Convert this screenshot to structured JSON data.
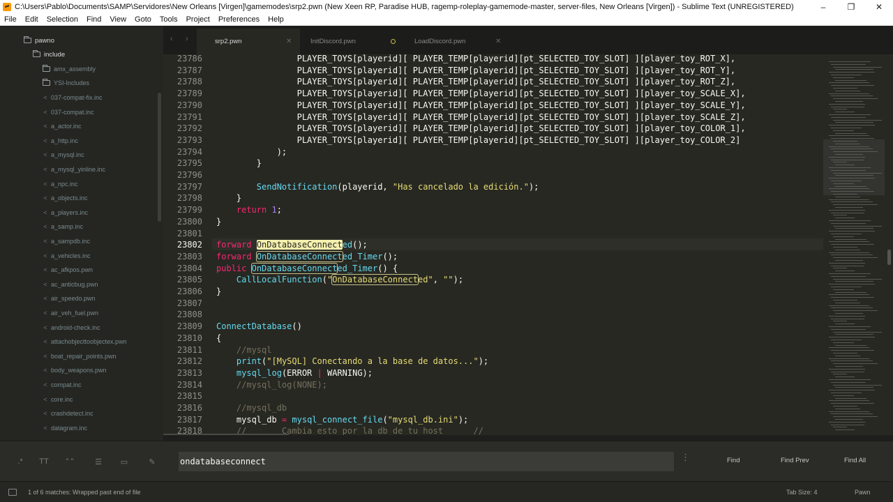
{
  "window": {
    "title": "C:\\Users\\Pablo\\Documents\\SAMP\\Servidores\\New Orleans [Virgen]\\gamemodes\\srp2.pwn (New Xeen RP, Paradise HUB, ragemp-roleplay-gamemode-master, server-files, New Orleans [Virgen]) - Sublime Text (UNREGISTERED)",
    "minimize": "–",
    "maximize": "❐",
    "close": "✕"
  },
  "menu": [
    "File",
    "Edit",
    "Selection",
    "Find",
    "View",
    "Goto",
    "Tools",
    "Project",
    "Preferences",
    "Help"
  ],
  "sidebar": {
    "folders": [
      {
        "label": "pawno",
        "level": 0
      },
      {
        "label": "include",
        "level": 1
      },
      {
        "label": "amx_assembly",
        "level": 2
      },
      {
        "label": "YSI-Includes",
        "level": 2
      }
    ],
    "files": [
      "037-compat-fix.inc",
      "037-compat.inc",
      "a_actor.inc",
      "a_http.inc",
      "a_mysql.inc",
      "a_mysql_yinline.inc",
      "a_npc.inc",
      "a_objects.inc",
      "a_players.inc",
      "a_samp.inc",
      "a_sampdb.inc",
      "a_vehicles.inc",
      "ac_afkpos.pwn",
      "ac_anticbug.pwn",
      "air_speedo.pwn",
      "air_veh_fuel.pwn",
      "android-check.inc",
      "attachobjecttoobjectex.pwn",
      "boat_repair_points.pwn",
      "body_weapons.pwn",
      "compat.inc",
      "core.inc",
      "crashdetect.inc",
      "datagram.inc"
    ]
  },
  "tabs": [
    {
      "label": "srp2.pwn",
      "active": true,
      "dirty": false
    },
    {
      "label": "InitDiscord.pwn",
      "active": false,
      "dirty": true
    },
    {
      "label": "LoadDiscord.pwn",
      "active": false,
      "dirty": false
    }
  ],
  "tab_nav": {
    "back": "‹",
    "forward": "›",
    "close": "✕"
  },
  "editor": {
    "current_line": "23802",
    "lines": [
      {
        "no": "23786",
        "code": "                PLAYER_TOYS[playerid][ PLAYER_TEMP[playerid][pt_SELECTED_TOY_SLOT] ][player_toy_ROT_X],"
      },
      {
        "no": "23787",
        "code": "                PLAYER_TOYS[playerid][ PLAYER_TEMP[playerid][pt_SELECTED_TOY_SLOT] ][player_toy_ROT_Y],"
      },
      {
        "no": "23788",
        "code": "                PLAYER_TOYS[playerid][ PLAYER_TEMP[playerid][pt_SELECTED_TOY_SLOT] ][player_toy_ROT_Z],"
      },
      {
        "no": "23789",
        "code": "                PLAYER_TOYS[playerid][ PLAYER_TEMP[playerid][pt_SELECTED_TOY_SLOT] ][player_toy_SCALE_X],"
      },
      {
        "no": "23790",
        "code": "                PLAYER_TOYS[playerid][ PLAYER_TEMP[playerid][pt_SELECTED_TOY_SLOT] ][player_toy_SCALE_Y],"
      },
      {
        "no": "23791",
        "code": "                PLAYER_TOYS[playerid][ PLAYER_TEMP[playerid][pt_SELECTED_TOY_SLOT] ][player_toy_SCALE_Z],"
      },
      {
        "no": "23792",
        "code": "                PLAYER_TOYS[playerid][ PLAYER_TEMP[playerid][pt_SELECTED_TOY_SLOT] ][player_toy_COLOR_1],"
      },
      {
        "no": "23793",
        "code": "                PLAYER_TOYS[playerid][ PLAYER_TEMP[playerid][pt_SELECTED_TOY_SLOT] ][player_toy_COLOR_2]"
      },
      {
        "no": "23794",
        "code": "            );"
      },
      {
        "no": "23795",
        "code": "        }"
      },
      {
        "no": "23796",
        "code": ""
      },
      {
        "no": "23797",
        "code": "        SendNotification(playerid, \"Has cancelado la edición.\");"
      },
      {
        "no": "23798",
        "code": "    }"
      },
      {
        "no": "23799",
        "code": "    return 1;"
      },
      {
        "no": "23800",
        "code": "}"
      },
      {
        "no": "23801",
        "code": ""
      },
      {
        "no": "23802",
        "code": "forward OnDatabaseConnected();"
      },
      {
        "no": "23803",
        "code": "forward OnDatabaseConnected_Timer();"
      },
      {
        "no": "23804",
        "code": "public OnDatabaseConnected_Timer() {"
      },
      {
        "no": "23805",
        "code": "    CallLocalFunction(\"OnDatabaseConnected\", \"\");"
      },
      {
        "no": "23806",
        "code": "}"
      },
      {
        "no": "23807",
        "code": ""
      },
      {
        "no": "23808",
        "code": ""
      },
      {
        "no": "23809",
        "code": "ConnectDatabase()"
      },
      {
        "no": "23810",
        "code": "{"
      },
      {
        "no": "23811",
        "code": "    //mysql"
      },
      {
        "no": "23812",
        "code": "    print(\"[MySQL] Conectando a la base de datos...\");"
      },
      {
        "no": "23813",
        "code": "    mysql_log(ERROR | WARNING);"
      },
      {
        "no": "23814",
        "code": "    //mysql_log(NONE);"
      },
      {
        "no": "23815",
        "code": ""
      },
      {
        "no": "23816",
        "code": "    //mysql_db"
      },
      {
        "no": "23817",
        "code": "    mysql_db = mysql_connect_file(\"mysql_db.ini\");"
      },
      {
        "no": "23818",
        "code": "    //       Cambia esto por la db de tu host      //"
      }
    ]
  },
  "find": {
    "value": "ondatabaseconnect",
    "options": [
      {
        "name": "regex-toggle",
        "glyph": ".*"
      },
      {
        "name": "case-toggle",
        "glyph": "TT"
      },
      {
        "name": "whole-word-toggle",
        "glyph": "\" \""
      },
      {
        "name": "wrap-toggle",
        "glyph": "☰"
      },
      {
        "name": "in-selection-toggle",
        "glyph": "▭"
      },
      {
        "name": "highlight-toggle",
        "glyph": "✎"
      }
    ],
    "more": "⋮",
    "find_label": "Find",
    "find_prev_label": "Find Prev",
    "find_all_label": "Find All"
  },
  "status": {
    "message": "1 of 6 matches: Wrapped past end of file",
    "tab_size": "Tab Size: 4",
    "syntax": "Pawn"
  },
  "colors": {
    "keyword": "#f92672",
    "function": "#66d9ef",
    "string": "#e6db74",
    "number": "#ae81ff",
    "comment": "#75715e",
    "background": "#272822"
  }
}
